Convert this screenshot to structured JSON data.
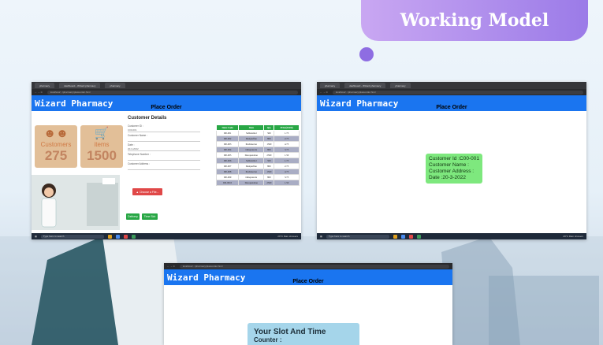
{
  "title": "Working Model",
  "browser": {
    "tab_label": "pharmacy",
    "tab_label_2": "dashboard - Wizard pharmacy",
    "tab_label_3": "pharmacy",
    "url": "localhost/.../pharmacy/placeorder.html"
  },
  "app": {
    "brand": "Wizard Pharmacy",
    "page_title": "Place Order",
    "page_title_3": "Place Order"
  },
  "screen1": {
    "section_title": "Customer Details",
    "stats": [
      {
        "label": "Customers",
        "value": "275",
        "icon": "people-icon"
      },
      {
        "label": "items",
        "value": "1500",
        "icon": "cart-icon"
      }
    ],
    "form": {
      "customer_id_label": "Customer ID :",
      "customer_id_value": "C00-001",
      "customer_name_label": "Customer Name :",
      "date_label": "Date :",
      "date_value": "20-3-2022",
      "telephone_label": "Telephone Number :",
      "address_label": "Customer Address :"
    },
    "choose_file_label": "Choose a File...",
    "buttons": {
      "delivery": "Delivery",
      "time_slot": "Time Slot"
    },
    "table": {
      "headers": [
        "Item Code",
        "Item",
        "Qty",
        "Price(LKR)"
      ],
      "rows": [
        [
          "I00-001",
          "Salbutamol",
          "500",
          "1.75"
        ],
        [
          "I00-002",
          "Desipurfine",
          "800",
          "2.75"
        ],
        [
          "I00-003",
          "Prednisolon",
          "1500",
          "4.75"
        ],
        [
          "I00-004",
          "Omeprazole",
          "800",
          "3.75"
        ],
        [
          "I00-005",
          "Desopendone",
          "2500",
          "1.50"
        ],
        [
          "I00-006",
          "Salbutamol",
          "500",
          "1.75"
        ],
        [
          "I00-007",
          "Desipurfine",
          "800",
          "2.75"
        ],
        [
          "I00-008",
          "Prednisolon",
          "1500",
          "4.75"
        ],
        [
          "I00-009",
          "Omeprazole",
          "800",
          "3.75"
        ],
        [
          "I00-0010",
          "Desopendone",
          "2500",
          "1.50"
        ]
      ]
    }
  },
  "screen2": {
    "customer_id": "Customer Id :C00-001",
    "customer_name": "Customer Name :",
    "customer_address": "Customer Address :",
    "date": "Date :20-3-2022"
  },
  "screen3": {
    "slot_title": "Your Slot And Time",
    "counter_label": "Counter :"
  },
  "taskbar": {
    "search": "Type here to search",
    "weather": "29°C  Rain showers"
  },
  "colors": {
    "appbar": "#1a75f0",
    "banner": "#9b7be8",
    "green": "#28a745",
    "stat_bg": "#e2bf98"
  }
}
